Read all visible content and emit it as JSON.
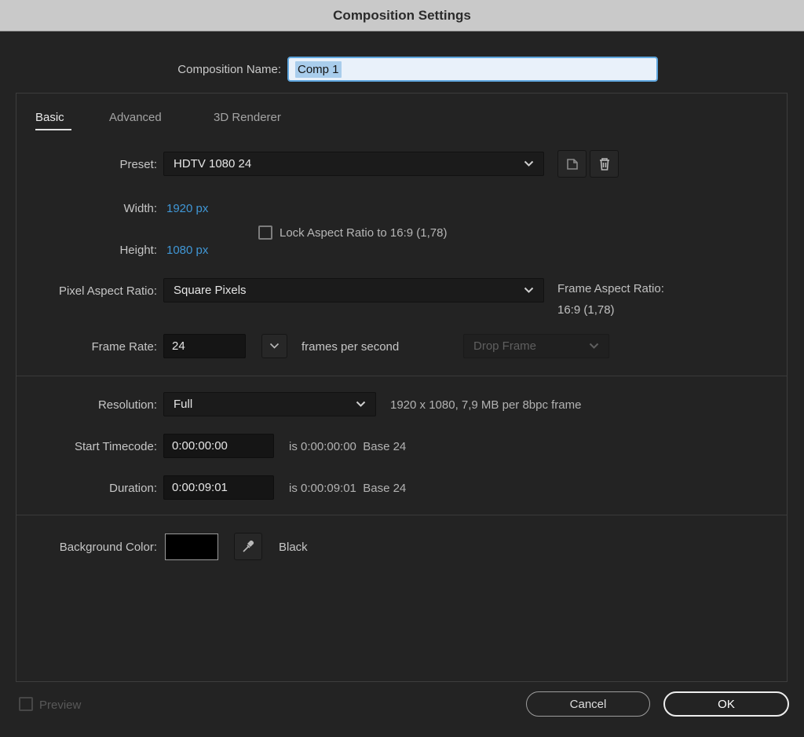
{
  "window": {
    "title": "Composition Settings"
  },
  "name_row": {
    "label": "Composition Name:",
    "value": "Comp 1"
  },
  "tabs": [
    {
      "label": "Basic",
      "active": true
    },
    {
      "label": "Advanced",
      "active": false
    },
    {
      "label": "3D Renderer",
      "active": false
    }
  ],
  "basic": {
    "preset": {
      "label": "Preset:",
      "value": "HDTV 1080 24"
    },
    "width": {
      "label": "Width:",
      "value": "1920",
      "unit": "px"
    },
    "height": {
      "label": "Height:",
      "value": "1080",
      "unit": "px"
    },
    "lock_aspect": {
      "label": "Lock Aspect Ratio to 16:9 (1,78)",
      "checked": false
    },
    "pixel_aspect": {
      "label": "Pixel Aspect Ratio:",
      "value": "Square Pixels"
    },
    "frame_aspect": {
      "label": "Frame Aspect Ratio:",
      "value": "16:9 (1,78)"
    },
    "frame_rate": {
      "label": "Frame Rate:",
      "value": "24",
      "suffix": "frames per second",
      "drop_frame_value": "Drop Frame"
    },
    "resolution": {
      "label": "Resolution:",
      "value": "Full",
      "info": "1920 x 1080, 7,9 MB per 8bpc frame"
    },
    "start_timecode": {
      "label": "Start Timecode:",
      "value": "0:00:00:00",
      "info": "is 0:00:00:00  Base 24"
    },
    "duration": {
      "label": "Duration:",
      "value": "0:00:09:01",
      "info": "is 0:00:09:01  Base 24"
    },
    "background_color": {
      "label": "Background Color:",
      "color_name": "Black",
      "color_hex": "#000000"
    }
  },
  "footer": {
    "preview_label": "Preview",
    "cancel_label": "Cancel",
    "ok_label": "OK"
  },
  "colors": {
    "accent_blue": "#4097d6",
    "dialog_bg": "#232323",
    "titlebar_bg": "#c9c9c9"
  }
}
